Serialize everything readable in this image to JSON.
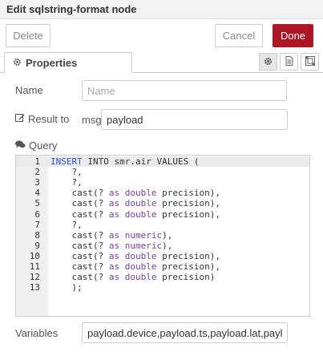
{
  "dialog": {
    "title": "Edit sqlstring-format node",
    "delete_label": "Delete",
    "cancel_label": "Cancel",
    "done_label": "Done"
  },
  "tabs": {
    "properties_label": "Properties"
  },
  "form": {
    "name_label": "Name",
    "name_placeholder": "Name",
    "name_value": "",
    "result_label": "Result to",
    "result_prefix": "msg.",
    "result_value": "payload",
    "query_label": "Query",
    "variables_label": "Variables",
    "variables_value": "payload.device,payload.ts,payload.lat,payload.lon"
  },
  "editor": {
    "active_line": 1,
    "lines": [
      {
        "num": "1",
        "segments": [
          {
            "t": "INSERT",
            "c": "kw-blue"
          },
          {
            "t": " INTO smr.air VALUES (",
            "c": ""
          }
        ]
      },
      {
        "num": "2",
        "segments": [
          {
            "t": "    ?,",
            "c": ""
          }
        ]
      },
      {
        "num": "3",
        "segments": [
          {
            "t": "    ?,",
            "c": ""
          }
        ]
      },
      {
        "num": "4",
        "segments": [
          {
            "t": "    cast(? ",
            "c": ""
          },
          {
            "t": "as",
            "c": "kw-purple"
          },
          {
            "t": " ",
            "c": ""
          },
          {
            "t": "double",
            "c": "kw-purple"
          },
          {
            "t": " precision),",
            "c": ""
          }
        ]
      },
      {
        "num": "5",
        "segments": [
          {
            "t": "    cast(? ",
            "c": ""
          },
          {
            "t": "as",
            "c": "kw-purple"
          },
          {
            "t": " ",
            "c": ""
          },
          {
            "t": "double",
            "c": "kw-purple"
          },
          {
            "t": " precision),",
            "c": ""
          }
        ]
      },
      {
        "num": "6",
        "segments": [
          {
            "t": "    cast(? ",
            "c": ""
          },
          {
            "t": "as",
            "c": "kw-purple"
          },
          {
            "t": " ",
            "c": ""
          },
          {
            "t": "double",
            "c": "kw-purple"
          },
          {
            "t": " precision),",
            "c": ""
          }
        ]
      },
      {
        "num": "7",
        "segments": [
          {
            "t": "    ?,",
            "c": ""
          }
        ]
      },
      {
        "num": "8",
        "segments": [
          {
            "t": "    cast(? ",
            "c": ""
          },
          {
            "t": "as",
            "c": "kw-purple"
          },
          {
            "t": " ",
            "c": ""
          },
          {
            "t": "numeric",
            "c": "kw-purple"
          },
          {
            "t": "),",
            "c": ""
          }
        ]
      },
      {
        "num": "9",
        "segments": [
          {
            "t": "    cast(? ",
            "c": ""
          },
          {
            "t": "as",
            "c": "kw-purple"
          },
          {
            "t": " ",
            "c": ""
          },
          {
            "t": "numeric",
            "c": "kw-purple"
          },
          {
            "t": "),",
            "c": ""
          }
        ]
      },
      {
        "num": "10",
        "segments": [
          {
            "t": "    cast(? ",
            "c": ""
          },
          {
            "t": "as",
            "c": "kw-purple"
          },
          {
            "t": " ",
            "c": ""
          },
          {
            "t": "double",
            "c": "kw-purple"
          },
          {
            "t": " precision),",
            "c": ""
          }
        ]
      },
      {
        "num": "11",
        "segments": [
          {
            "t": "    cast(? ",
            "c": ""
          },
          {
            "t": "as",
            "c": "kw-purple"
          },
          {
            "t": " ",
            "c": ""
          },
          {
            "t": "double",
            "c": "kw-purple"
          },
          {
            "t": " precision),",
            "c": ""
          }
        ]
      },
      {
        "num": "12",
        "segments": [
          {
            "t": "    cast(? ",
            "c": ""
          },
          {
            "t": "as",
            "c": "kw-purple"
          },
          {
            "t": " ",
            "c": ""
          },
          {
            "t": "double",
            "c": "kw-purple"
          },
          {
            "t": " precision)",
            "c": ""
          }
        ]
      },
      {
        "num": "13",
        "segments": [
          {
            "t": "    );",
            "c": ""
          }
        ]
      }
    ]
  },
  "icons": {
    "tab_properties": "gear-icon",
    "tab_button_1": "gear-icon",
    "tab_button_2": "document-icon",
    "tab_button_3": "layout-icon",
    "name": "tag-icon",
    "result": "edit-icon",
    "query": "comments-icon"
  },
  "colors": {
    "done_button": "#ad1625",
    "keyword_blue": "#2f4fd0",
    "keyword_purple": "#7a3e9d"
  }
}
